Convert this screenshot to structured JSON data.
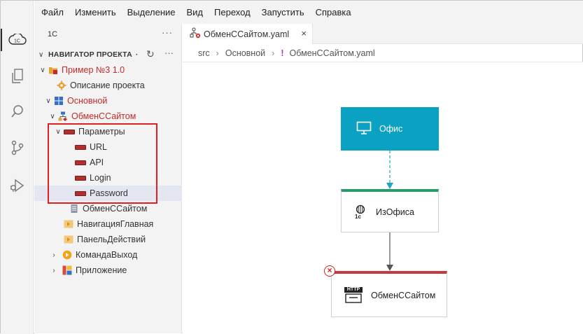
{
  "menu": {
    "items": [
      "Файл",
      "Изменить",
      "Выделение",
      "Вид",
      "Переход",
      "Запустить",
      "Справка"
    ]
  },
  "sidebar": {
    "title": "1С",
    "section_label": "НАВИГАТОР ПРОЕКТА",
    "section_bullet": "·",
    "tree": [
      {
        "label": "Пример №3 1.0",
        "icon": "project-folder-icon",
        "red": true
      },
      {
        "label": "Описание проекта",
        "icon": "gear-icon",
        "red": false
      },
      {
        "label": "Основной",
        "icon": "subsystem-icon",
        "red": true
      },
      {
        "label": "ОбменССайтом",
        "icon": "exchange-tree-icon",
        "red": true
      },
      {
        "label": "Параметры",
        "icon": "attribute-icon",
        "red": false
      },
      {
        "label": "URL",
        "icon": "attribute-icon",
        "red": false
      },
      {
        "label": "API",
        "icon": "attribute-icon",
        "red": false
      },
      {
        "label": "Login",
        "icon": "attribute-icon",
        "red": false
      },
      {
        "label": "Password",
        "icon": "attribute-icon",
        "red": false
      },
      {
        "label": "ОбменССайтом",
        "icon": "document-icon",
        "red": false
      },
      {
        "label": "НавигацияГлавная",
        "icon": "form-icon",
        "red": false
      },
      {
        "label": "ПанельДействий",
        "icon": "form-icon",
        "red": false
      },
      {
        "label": "КомандаВыход",
        "icon": "command-icon",
        "red": false
      },
      {
        "label": "Приложение",
        "icon": "application-icon",
        "red": false
      }
    ]
  },
  "editor": {
    "tab_label": "ОбменССайтом.yaml",
    "breadcrumbs": [
      "src",
      "Основной",
      "ОбменССайтом.yaml"
    ],
    "breadcrumb_bang": "!"
  },
  "diagram": {
    "node_office": "Офис",
    "node_from_office": "ИзОфиса",
    "node_from_office_badge": "1с",
    "node_exchange": "ОбменССайтом",
    "node_exchange_badge": "HTTP",
    "colors": {
      "office": "#0aa1c2",
      "from_top": "#2e9a6a",
      "exchange_top": "#c8373a",
      "error": "#d12020"
    }
  }
}
